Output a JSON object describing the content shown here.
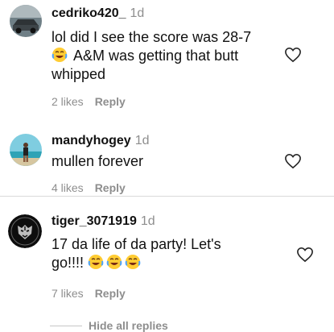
{
  "comments": [
    {
      "username": "cedriko420_",
      "time": "1d",
      "line1": "lol did I see the score was 28-7",
      "line2_emoji": "face-with-tears-of-joy",
      "line2": "A&M was getting that butt",
      "line3": "whipped",
      "likes": "2 likes",
      "reply": "Reply",
      "avatar_icon": "car-photo-avatar"
    },
    {
      "username": "mandyhogey",
      "time": "1d",
      "line1": "mullen forever",
      "likes": "4 likes",
      "reply": "Reply",
      "avatar_icon": "beach-photo-avatar"
    },
    {
      "username": "tiger_3071919",
      "time": "1d",
      "line1": "17 da life of da party! Let's",
      "line2": "go!!!!",
      "line2_emojis": [
        "face-with-tears-of-joy",
        "face-with-tears-of-joy",
        "face-with-tears-of-joy"
      ],
      "likes": "7 likes",
      "reply": "Reply",
      "avatar_icon": "tiger-logo-avatar"
    }
  ],
  "hide_replies": "Hide all replies",
  "colors": {
    "text": "#111111",
    "muted": "#8e8e8e",
    "separator": "#d9d9d9"
  }
}
